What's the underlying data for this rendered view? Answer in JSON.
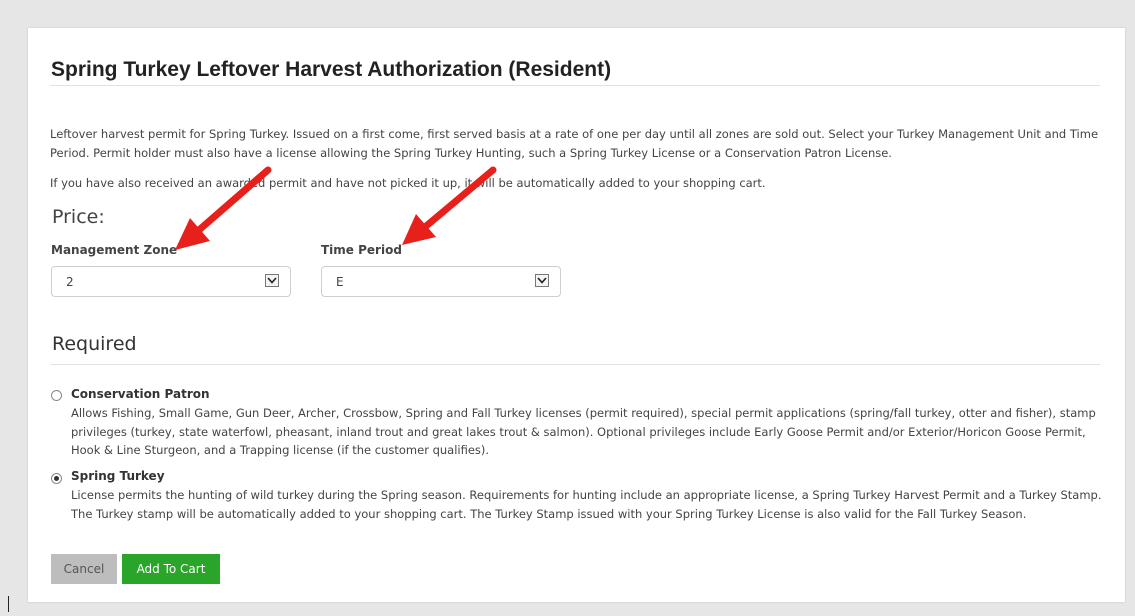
{
  "form": {
    "title": "Spring Turkey Leftover Harvest Authorization (Resident)",
    "description_1": "Leftover harvest permit for Spring Turkey. Issued on a first come, first served basis at a rate of one per day until all zones are sold out. Select your Turkey Management Unit and Time Period. Permit holder must also have a license allowing the Spring Turkey Hunting, such a Spring Turkey License or a Conservation Patron License.",
    "description_2": "If you have also received an awarded permit and have not picked it up, it will be automatically added to your shopping cart.",
    "price_heading": "Price:"
  },
  "fields": {
    "management_zone": {
      "label": "Management Zone",
      "value": "2"
    },
    "time_period": {
      "label": "Time Period",
      "value": "E"
    }
  },
  "required": {
    "heading": "Required",
    "options": [
      {
        "title": "Conservation Patron",
        "description": "Allows Fishing, Small Game, Gun Deer, Archer, Crossbow, Spring and Fall Turkey licenses (permit required), special permit applications (spring/fall turkey, otter and fisher), stamp privileges (turkey, state waterfowl, pheasant, inland trout and great lakes trout & salmon). Optional privileges include Early Goose Permit and/or Exterior/Horicon Goose Permit, Hook & Line Sturgeon, and a Trapping license (if the customer qualifies).",
        "selected": false
      },
      {
        "title": "Spring Turkey",
        "description": "License permits the hunting of wild turkey during the Spring season. Requirements for hunting include an appropriate license, a Spring Turkey Harvest Permit and a Turkey Stamp. The Turkey stamp will be automatically added to your shopping cart. The Turkey Stamp issued with your Spring Turkey License is also valid for the Fall Turkey Season.",
        "selected": true
      }
    ]
  },
  "buttons": {
    "cancel": "Cancel",
    "add_to_cart": "Add To Cart"
  },
  "colors": {
    "add_button": "#2aa52a",
    "cancel_button": "#bdbdbd",
    "annotation_arrow": "#e8201c"
  },
  "icons": {
    "dropdown": "chevron-down-icon",
    "annotation": "red-arrow-icon"
  }
}
